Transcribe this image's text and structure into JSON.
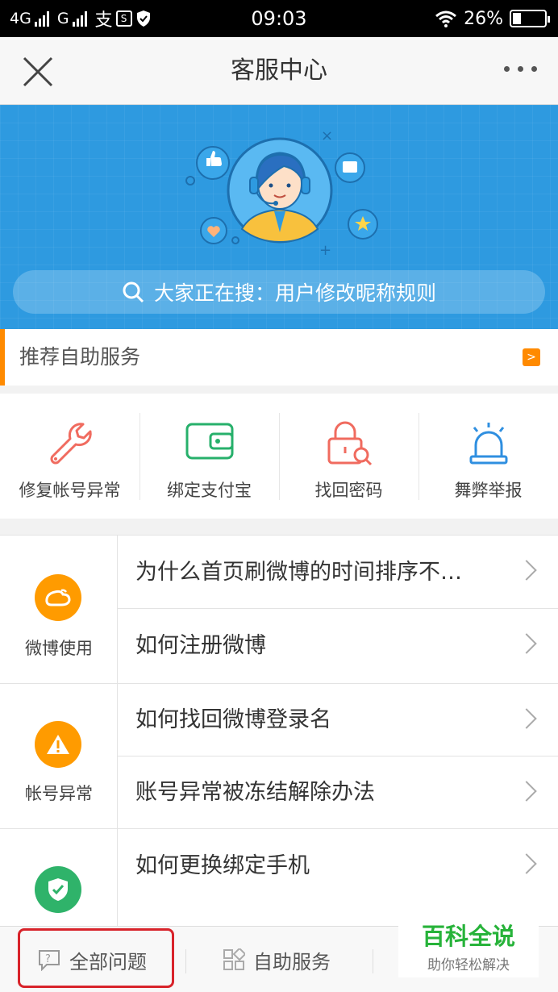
{
  "status_bar": {
    "network1": "4G",
    "network2": "G",
    "time": "09:03",
    "battery": "26%",
    "battery_level": 0.26,
    "app_icons": [
      "alipay-icon",
      "s-icon",
      "shield-icon"
    ]
  },
  "nav": {
    "title": "客服中心",
    "close_icon": "close-icon",
    "more_icon": "more-icon"
  },
  "banner": {
    "search_text": "大家正在搜：用户修改昵称规则",
    "background": "#2e9ae0"
  },
  "recommend": {
    "title": "推荐自助服务",
    "accent": "#ff8a00"
  },
  "services": [
    {
      "label": "修复帐号异常",
      "icon": "wrench-icon",
      "color": "#f06b5f"
    },
    {
      "label": "绑定支付宝",
      "icon": "wallet-icon",
      "color": "#27b06b"
    },
    {
      "label": "找回密码",
      "icon": "lock-search-icon",
      "color": "#f06b5f"
    },
    {
      "label": "舞弊举报",
      "icon": "alarm-icon",
      "color": "#2f8fe0"
    }
  ],
  "faq": [
    {
      "category": "微博使用",
      "icon": "weibo-icon",
      "color": "#ff9b00",
      "questions": [
        "为什么首页刷微博的时间排序不…",
        "如何注册微博"
      ]
    },
    {
      "category": "帐号异常",
      "icon": "warning-icon",
      "color": "#ff9b00",
      "questions": [
        "如何找回微博登录名",
        "账号异常被冻结解除办法"
      ]
    },
    {
      "category": "",
      "icon": "shield-check-icon",
      "color": "#2fb36a",
      "questions": [
        "如何更换绑定手机"
      ]
    }
  ],
  "tabbar": {
    "all_questions": "全部问题",
    "self_service": "自助服务"
  },
  "watermark": {
    "title": "百科全说",
    "subtitle": "助你轻松解决"
  }
}
